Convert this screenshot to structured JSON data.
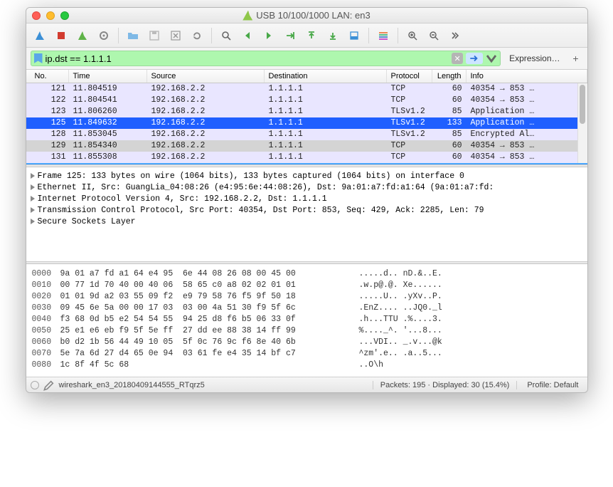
{
  "window": {
    "title": "USB 10/100/1000 LAN: en3"
  },
  "filter": {
    "value": "ip.dst == 1.1.1.1",
    "expression_label": "Expression…"
  },
  "columns": {
    "no": "No.",
    "time": "Time",
    "source": "Source",
    "destination": "Destination",
    "protocol": "Protocol",
    "length": "Length",
    "info": "Info"
  },
  "packets": [
    {
      "no": "121",
      "time": "11.804519",
      "src": "192.168.2.2",
      "dst": "1.1.1.1",
      "proto": "TCP",
      "len": "60",
      "info": "40354 → 853 …",
      "cls": "row-default"
    },
    {
      "no": "122",
      "time": "11.804541",
      "src": "192.168.2.2",
      "dst": "1.1.1.1",
      "proto": "TCP",
      "len": "60",
      "info": "40354 → 853 …",
      "cls": "row-default"
    },
    {
      "no": "123",
      "time": "11.806260",
      "src": "192.168.2.2",
      "dst": "1.1.1.1",
      "proto": "TLSv1.2",
      "len": "85",
      "info": "Application …",
      "cls": "row-default"
    },
    {
      "no": "125",
      "time": "11.849632",
      "src": "192.168.2.2",
      "dst": "1.1.1.1",
      "proto": "TLSv1.2",
      "len": "133",
      "info": "Application …",
      "cls": "row-selected"
    },
    {
      "no": "128",
      "time": "11.853045",
      "src": "192.168.2.2",
      "dst": "1.1.1.1",
      "proto": "TLSv1.2",
      "len": "85",
      "info": "Encrypted Al…",
      "cls": "row-default"
    },
    {
      "no": "129",
      "time": "11.854340",
      "src": "192.168.2.2",
      "dst": "1.1.1.1",
      "proto": "TCP",
      "len": "60",
      "info": "40354 → 853 …",
      "cls": "row-shaded"
    },
    {
      "no": "131",
      "time": "11.855308",
      "src": "192.168.2.2",
      "dst": "1.1.1.1",
      "proto": "TCP",
      "len": "60",
      "info": "40354 → 853 …",
      "cls": "row-default"
    }
  ],
  "details": [
    "Frame 125: 133 bytes on wire (1064 bits), 133 bytes captured (1064 bits) on interface 0",
    "Ethernet II, Src: GuangLia_04:08:26 (e4:95:6e:44:08:26), Dst: 9a:01:a7:fd:a1:64 (9a:01:a7:fd:",
    "Internet Protocol Version 4, Src: 192.168.2.2, Dst: 1.1.1.1",
    "Transmission Control Protocol, Src Port: 40354, Dst Port: 853, Seq: 429, Ack: 2285, Len: 79",
    "Secure Sockets Layer"
  ],
  "hex": [
    {
      "off": "0000",
      "b": "9a 01 a7 fd a1 64 e4 95  6e 44 08 26 08 00 45 00",
      "a": ".....d.. nD.&..E."
    },
    {
      "off": "0010",
      "b": "00 77 1d 70 40 00 40 06  58 65 c0 a8 02 02 01 01",
      "a": ".w.p@.@. Xe......"
    },
    {
      "off": "0020",
      "b": "01 01 9d a2 03 55 09 f2  e9 79 58 76 f5 9f 50 18",
      "a": ".....U.. .yXv..P."
    },
    {
      "off": "0030",
      "b": "09 45 6e 5a 00 00 17 03  03 00 4a 51 30 f9 5f 6c",
      "a": ".EnZ.... ..JQ0._l"
    },
    {
      "off": "0040",
      "b": "f3 68 0d b5 e2 54 54 55  94 25 d8 f6 b5 06 33 0f",
      "a": ".h...TTU .%....3."
    },
    {
      "off": "0050",
      "b": "25 e1 e6 eb f9 5f 5e ff  27 dd ee 88 38 14 ff 99",
      "a": "%...._^. '...8..."
    },
    {
      "off": "0060",
      "b": "b0 d2 1b 56 44 49 10 05  5f 0c 76 9c f6 8e 40 6b",
      "a": "...VDI.. _.v...@k"
    },
    {
      "off": "0070",
      "b": "5e 7a 6d 27 d4 65 0e 94  03 61 fe e4 35 14 bf c7",
      "a": "^zm'.e.. .a..5..."
    },
    {
      "off": "0080",
      "b": "1c 8f 4f 5c 68",
      "a": "..O\\h"
    }
  ],
  "status": {
    "file": "wireshark_en3_20180409144555_RTqrz5",
    "packets": "Packets: 195 · Displayed: 30 (15.4%)",
    "profile": "Profile: Default"
  }
}
